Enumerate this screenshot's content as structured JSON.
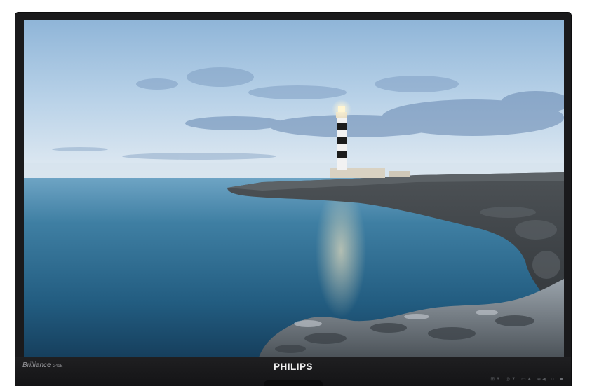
{
  "monitor": {
    "model_label": "Brilliance",
    "model_number": "241B",
    "logo_text": "PHILIPS"
  },
  "controls": [
    {
      "icon": "input-icon",
      "symbol": "⊞",
      "label": "▼"
    },
    {
      "icon": "menu-icon",
      "symbol": "◎",
      "label": "▼"
    },
    {
      "icon": "preset-icon",
      "symbol": "▭",
      "label": "▲"
    },
    {
      "icon": "power-saving-icon",
      "symbol": "◈",
      "label": "◀"
    },
    {
      "icon": "settings-icon",
      "symbol": "○",
      "label": ""
    }
  ],
  "colors": {
    "bezel": "#1a1a1c",
    "sky_top": "#a9c7e2",
    "sea": "#2f6f8f"
  }
}
